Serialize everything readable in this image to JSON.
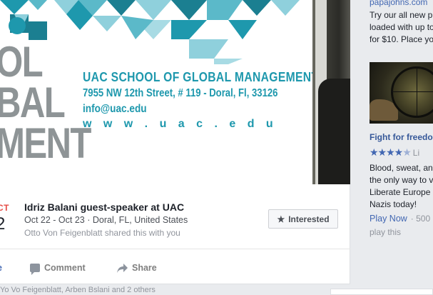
{
  "banner": {
    "big_letters": [
      "OL",
      "BAL",
      "MENT"
    ],
    "school_name": "UAC SCHOOL OF GLOBAL MANAGEMENT",
    "address": "7955 NW 12th Street, # 119 - Doral, Fl, 33126",
    "email": "info@uac.edu",
    "website": "w w w . u a c . e d u"
  },
  "event": {
    "month": "CT",
    "day": "2",
    "title": "Idriz Balani guest-speaker at UAC",
    "meta": "Oct 22 - Oct 23 · Doral, FL, United States",
    "shared_by": "Otto Von Feigenblatt shared this with you",
    "interested_label": "Interested"
  },
  "actions": {
    "like_label": "e",
    "comment_label": "Comment",
    "share_label": "Share"
  },
  "bottom_strip": "Yo Vo Feigenblatt, Arben Bslani and 2 others",
  "ads": {
    "ad1": {
      "domain": "papajohns.com",
      "lines": [
        "Try our all new p",
        "loaded with up to",
        "for $10. Place yo"
      ]
    },
    "ad2": {
      "title": "Fight for freedom",
      "stars_label": "Li",
      "lines": [
        "Blood, sweat, an",
        "the only way to v",
        "Liberate Europe",
        "Nazis today!"
      ],
      "cta": "Play Now",
      "cta_count": "· 500",
      "cta_tail": "play this"
    }
  },
  "colors": {
    "teal": "#1e98ad",
    "teal_light": "#8fd0dc",
    "teal_dark": "#1b7f91",
    "fb_blue": "#4267b2",
    "event_red": "#e64b45"
  }
}
